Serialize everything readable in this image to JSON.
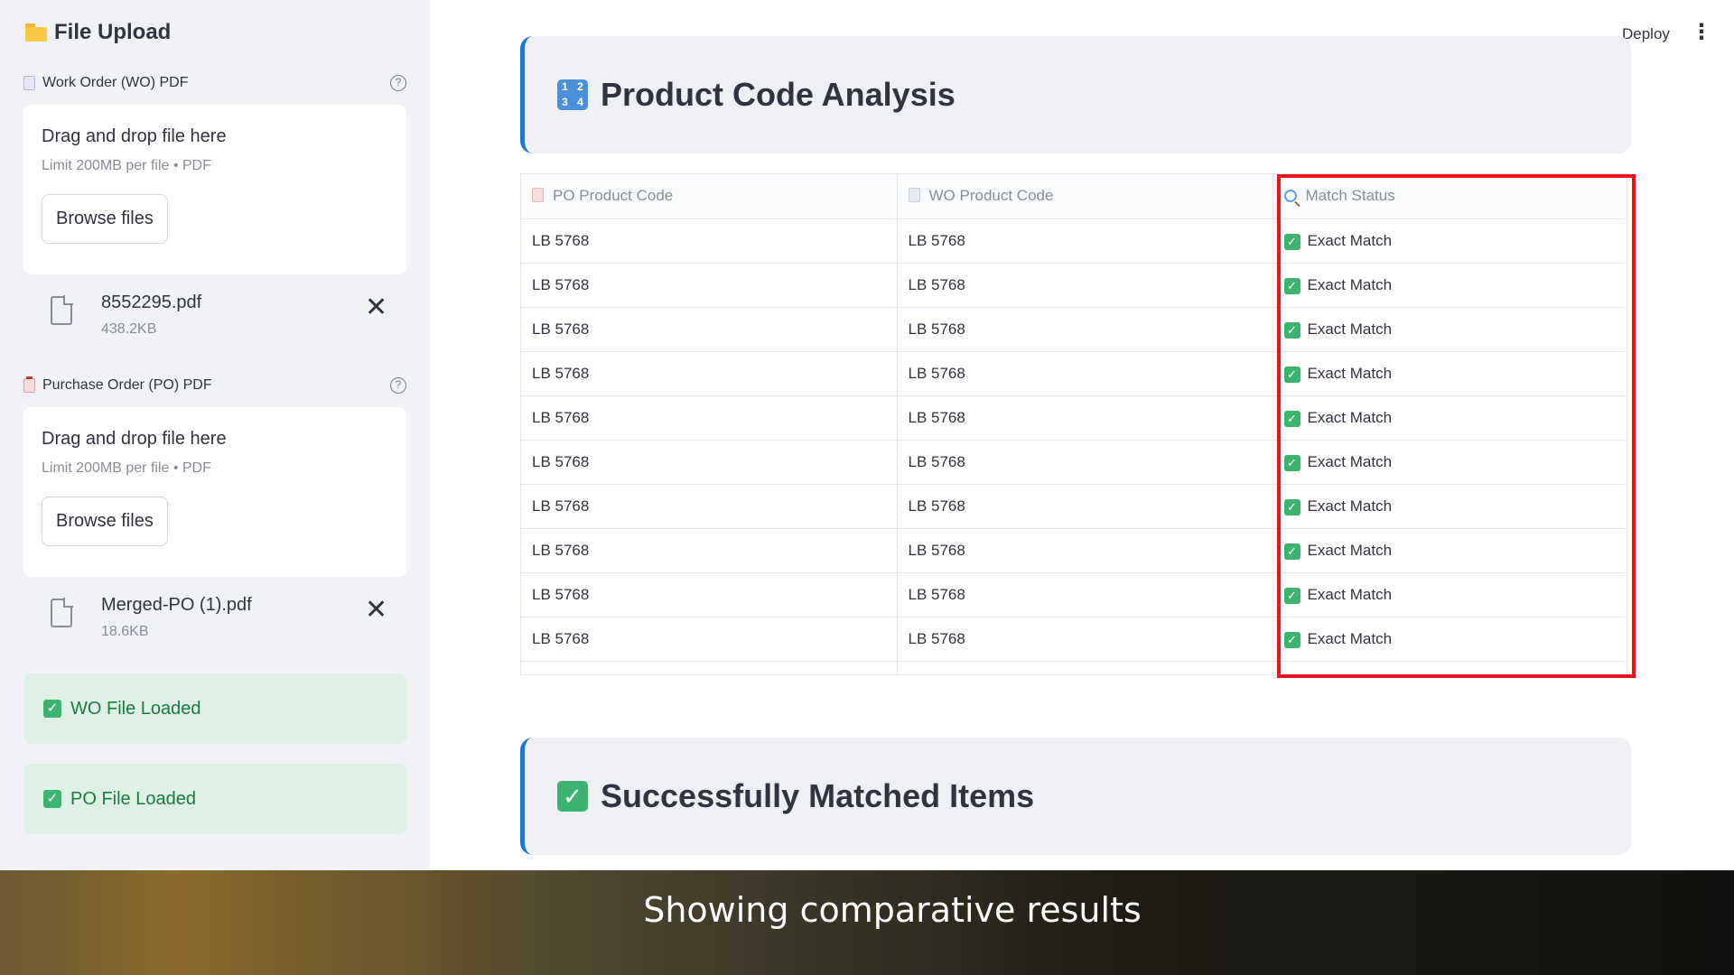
{
  "sidebar": {
    "title": "File Upload",
    "wo": {
      "label": "Work Order (WO) PDF",
      "help": "?",
      "drop_title": "Drag and drop file here",
      "limit": "Limit 200MB per file • PDF",
      "browse": "Browse files",
      "file_name": "8552295.pdf",
      "file_size": "438.2KB",
      "remove": "✕"
    },
    "po": {
      "label": "Purchase Order (PO) PDF",
      "help": "?",
      "drop_title": "Drag and drop file here",
      "limit": "Limit 200MB per file • PDF",
      "browse": "Browse files",
      "file_name": "Merged-PO (1).pdf",
      "file_size": "18.6KB",
      "remove": "✕"
    },
    "wo_loaded": "WO File Loaded",
    "po_loaded": "PO File Loaded"
  },
  "topbar": {
    "deploy": "Deploy",
    "menu": "⋮"
  },
  "analysis": {
    "title": "Product Code Analysis",
    "icon_digits": [
      "1",
      "2",
      "3",
      "4"
    ],
    "columns": [
      "PO Product Code",
      "WO Product Code",
      "Match Status"
    ],
    "rows": [
      [
        "LB 5768",
        "LB 5768",
        "Exact Match"
      ],
      [
        "LB 5768",
        "LB 5768",
        "Exact Match"
      ],
      [
        "LB 5768",
        "LB 5768",
        "Exact Match"
      ],
      [
        "LB 5768",
        "LB 5768",
        "Exact Match"
      ],
      [
        "LB 5768",
        "LB 5768",
        "Exact Match"
      ],
      [
        "LB 5768",
        "LB 5768",
        "Exact Match"
      ],
      [
        "LB 5768",
        "LB 5768",
        "Exact Match"
      ],
      [
        "LB 5768",
        "LB 5768",
        "Exact Match"
      ],
      [
        "LB 5768",
        "LB 5768",
        "Exact Match"
      ],
      [
        "LB 5768",
        "LB 5768",
        "Exact Match"
      ]
    ]
  },
  "matched": {
    "title": "Successfully Matched Items"
  },
  "caption": "Showing comparative results",
  "colors": {
    "accent": "#1f77d4",
    "highlight": "#e8131b",
    "success_bg": "#dff0e6",
    "success_text": "#1c7a3f"
  }
}
